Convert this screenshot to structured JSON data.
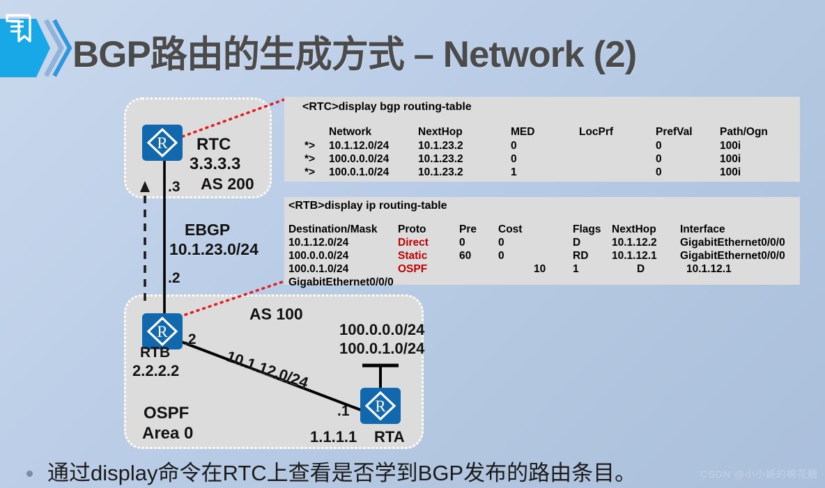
{
  "title": "BGP路由的生成方式 – Network (2)",
  "title_icon": "document-bookmark-icon",
  "watermark": "CSDN @小小妍的棉花糖",
  "bullet": "通过display命令在RTC上查看是否学到BGP发布的路由条目。",
  "colors": {
    "accent": "#18a8e8",
    "router": "#1268ad",
    "panel_bg": "#dcdcdc",
    "region_bg": "#dcdcdc",
    "red": "#c00000",
    "title": "#4b4b4b"
  },
  "diagram": {
    "as200": {
      "label": "AS 200",
      "router": "RTC",
      "router_id": "3.3.3.3",
      "iface_label": ".3"
    },
    "as100": {
      "label": "AS 100",
      "igp": "OSPF",
      "area": "Area 0",
      "routers": [
        {
          "name": "RTB",
          "id": "2.2.2.2",
          "iface_label": ".2"
        },
        {
          "name": "RTA",
          "id": "1.1.1.1",
          "iface_label": ".1"
        }
      ],
      "link_label": "10.1.12.0/24",
      "stub_networks": [
        "100.0.0.0/24",
        "100.0.1.0/24"
      ]
    },
    "ebgp": {
      "protocol": "EBGP",
      "subnet": "10.1.23.0/24",
      "top_iface": ".3",
      "bottom_iface": ".2"
    }
  },
  "panel_bgp": {
    "command": "<RTC>display bgp routing-table",
    "headers": [
      "Network",
      "NextHop",
      "MED",
      "LocPrf",
      "PrefVal",
      "Path/Ogn"
    ],
    "rows": [
      {
        "flag": "*>",
        "network": "10.1.12.0/24",
        "nexthop": "10.1.23.2",
        "med": "0",
        "locprf": "",
        "prefval": "0",
        "path": "100i"
      },
      {
        "flag": "*>",
        "network": "100.0.0.0/24",
        "nexthop": "10.1.23.2",
        "med": "0",
        "locprf": "",
        "prefval": "0",
        "path": "100i"
      },
      {
        "flag": "*>",
        "network": "100.0.1.0/24",
        "nexthop": "10.1.23.2",
        "med": "1",
        "locprf": "",
        "prefval": "0",
        "path": "100i"
      }
    ]
  },
  "panel_ip": {
    "command": "<RTB>display ip routing-table",
    "headers": [
      "Destination/Mask",
      "Proto",
      "Pre",
      "Cost",
      "Flags",
      "NextHop",
      "Interface"
    ],
    "rows": [
      {
        "dest": "10.1.12.0/24",
        "proto": "Direct",
        "pre": "0",
        "cost": "0",
        "cost2": "",
        "flags": "D",
        "nexthop": "10.1.12.2",
        "iface": "GigabitEthernet0/0/0"
      },
      {
        "dest": "100.0.0.0/24",
        "proto": "Static",
        "pre": "60",
        "cost": "0",
        "cost2": "",
        "flags": "RD",
        "nexthop": "10.1.12.1",
        "iface": "GigabitEthernet0/0/0"
      },
      {
        "dest": "100.0.1.0/24",
        "proto": "OSPF",
        "pre": "",
        "cost": "",
        "cost2": "10",
        "flags": "1",
        "nexthop": "D",
        "iface": "10.1.12.1"
      }
    ],
    "wrap_line": "GigabitEthernet0/0/0"
  }
}
